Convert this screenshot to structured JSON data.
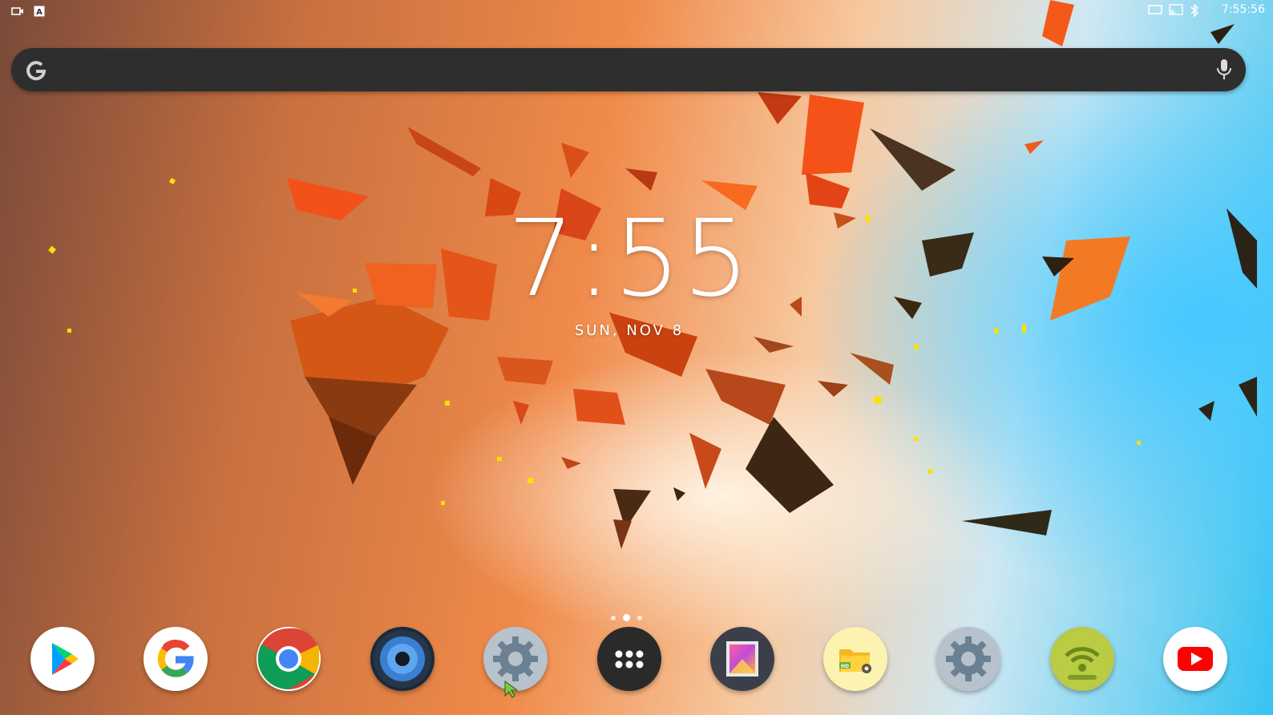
{
  "status_bar": {
    "time": "7:55:56",
    "left_icons": [
      "screen-record-icon",
      "keyboard-a-icon"
    ],
    "right_icons": [
      "screen-icon",
      "cast-icon",
      "bluetooth-icon"
    ]
  },
  "search_bar": {
    "logo": "google-g-icon",
    "mic": "mic-icon"
  },
  "clock": {
    "time": "7:55",
    "date": "SUN, NOV 8"
  },
  "page_indicator": {
    "pages": 3,
    "current": 2
  },
  "dock": [
    {
      "name": "play-store-icon"
    },
    {
      "name": "google-icon"
    },
    {
      "name": "chrome-icon"
    },
    {
      "name": "speaker-app-icon"
    },
    {
      "name": "settings-icon"
    },
    {
      "name": "app-drawer-icon"
    },
    {
      "name": "gallery-icon"
    },
    {
      "name": "file-manager-icon"
    },
    {
      "name": "settings-alt-icon"
    },
    {
      "name": "wifi-app-icon"
    },
    {
      "name": "youtube-icon"
    }
  ],
  "colors": {
    "search_bg": "#2e2e2e",
    "wallpaper_orange": "#f26a1b",
    "wallpaper_blue": "#35c3f2"
  }
}
